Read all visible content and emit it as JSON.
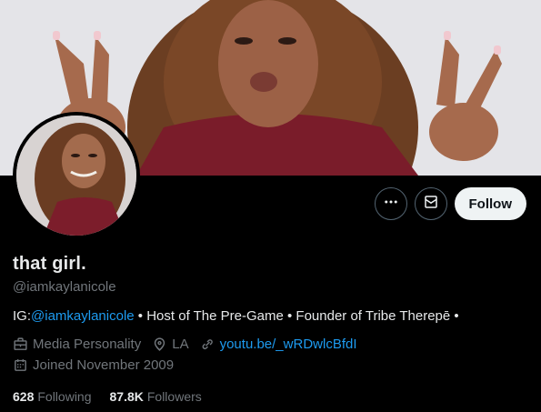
{
  "profile": {
    "display_name": "that girl.",
    "handle": "@iamkaylanicole",
    "bio": {
      "prefix": "IG:",
      "mention": "@iamkaylanicole",
      "rest": " • Host of The Pre-Game • Founder of Tribe Therepē •"
    },
    "category": "Media Personality",
    "location": "LA",
    "website": "youtu.be/_wRDwlcBfdI",
    "joined": "Joined November 2009",
    "following_count": "628",
    "following_label": "Following",
    "followers_count": "87.8K",
    "followers_label": "Followers"
  },
  "actions": {
    "more_icon": "more-icon",
    "message_icon": "envelope-icon",
    "follow_label": "Follow"
  },
  "colors": {
    "background": "#000000",
    "link": "#1d9bf0",
    "muted": "#71767b",
    "text": "#e7e9ea",
    "follow_bg": "#eff3f4"
  }
}
